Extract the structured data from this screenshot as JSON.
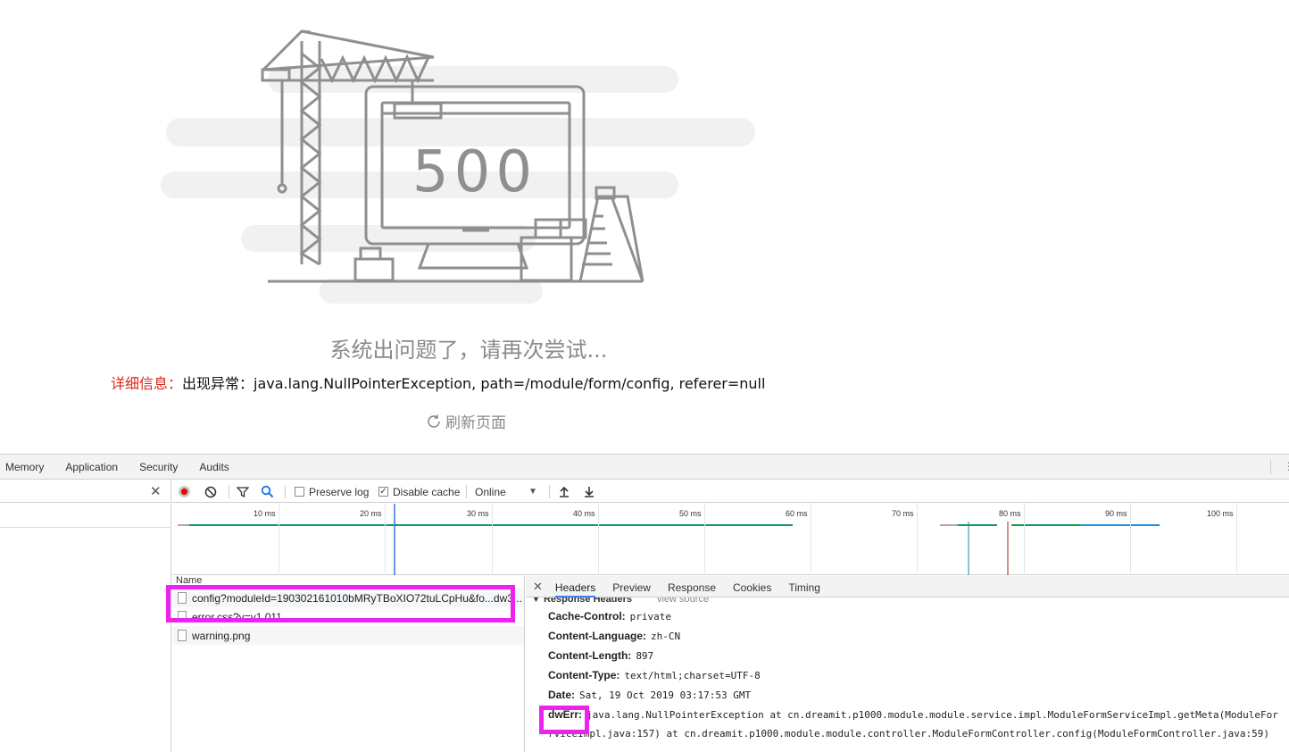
{
  "error_page": {
    "code": "500",
    "title": "系统出问题了，请再次尝试...",
    "detail_label": "详细信息：",
    "detail_message": "出现异常：java.lang.NullPointerException, path=/module/form/config, referer=null",
    "refresh_label": "刷新页面"
  },
  "devtools": {
    "tabs": [
      "Memory",
      "Application",
      "Security",
      "Audits"
    ],
    "toolbar": {
      "preserve_log": "Preserve log",
      "preserve_log_checked": false,
      "disable_cache": "Disable cache",
      "disable_cache_checked": true,
      "throttling": "Online"
    },
    "timeline_ticks": [
      "10 ms",
      "20 ms",
      "30 ms",
      "40 ms",
      "50 ms",
      "60 ms",
      "70 ms",
      "80 ms",
      "90 ms",
      "100 ms"
    ],
    "name_column": "Name",
    "requests": [
      "config?moduleId=190302161010bMRyTBoXIO72tuLCpHu&fo...dw3...",
      "error.css?v=v1.011",
      "warning.png"
    ],
    "detail_tabs": [
      "Headers",
      "Preview",
      "Response",
      "Cookies",
      "Timing"
    ],
    "active_detail_tab": "Headers",
    "section_title": "Response Headers",
    "view_source": "view source",
    "headers": [
      {
        "key": "Cache-Control:",
        "value": "private"
      },
      {
        "key": "Content-Language:",
        "value": "zh-CN"
      },
      {
        "key": "Content-Length:",
        "value": "897"
      },
      {
        "key": "Content-Type:",
        "value": "text/html;charset=UTF-8"
      },
      {
        "key": "Date:",
        "value": "Sat, 19 Oct 2019 03:17:53 GMT"
      },
      {
        "key": "dwErr:",
        "value": "java.lang.NullPointerException    at cn.dreamit.p1000.module.module.service.impl.ModuleFormServiceImpl.getMeta(ModuleFor"
      }
    ],
    "header_continuation": "rviceImpl.java:157)    at cn.dreamit.p1000.module.module.controller.ModuleFormController.config(ModuleFormController.java:59)"
  }
}
